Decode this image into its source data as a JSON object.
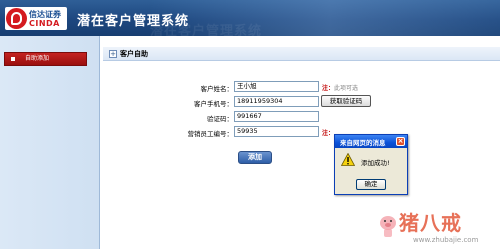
{
  "header": {
    "logo_cn": "信达证券",
    "logo_en": "CINDA",
    "app_title": "潜在客户管理系统",
    "ghost_text": "潜在客户管理系统"
  },
  "sidebar": {
    "items": [
      {
        "label": "自助添加"
      }
    ]
  },
  "panel": {
    "title": "客户自助"
  },
  "form": {
    "name_label": "客户姓名：",
    "name_value": "王小旭",
    "name_note_mark": "注：",
    "name_note_text": "此项可选",
    "phone_label": "客户手机号：",
    "phone_value": "18911959304",
    "get_code_label": "获取验证码",
    "code_label": "验证码：",
    "code_value": "991667",
    "employee_label": "营销员工编号：",
    "employee_value": "59935",
    "employee_note_mark": "注：",
    "submit_label": "添加"
  },
  "dialog": {
    "title": "来自网页的消息",
    "message": "添加成功!",
    "ok_label": "确定",
    "icon": "warning-icon"
  },
  "watermark": {
    "text": "猪八戒",
    "url": "www.zhubajie.com"
  },
  "colors": {
    "header_bg": "#1d477f",
    "sidebar_item_bg": "#b0181a",
    "note_red": "#c00000",
    "dialog_title_bg": "#0a51d8",
    "submit_bg": "#2e5ea7"
  }
}
